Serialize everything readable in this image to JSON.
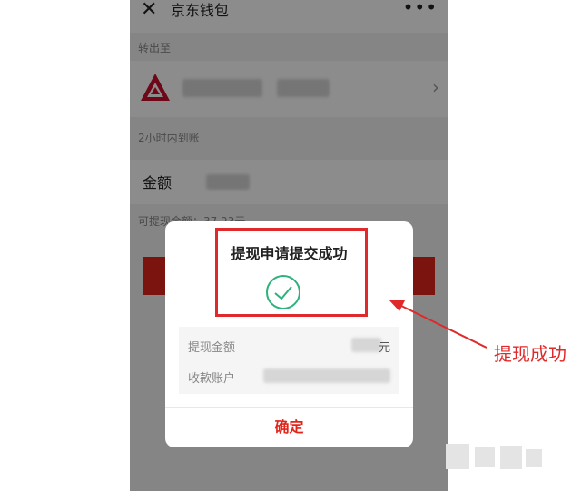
{
  "header": {
    "title": "京东钱包",
    "close_icon": "✕",
    "more_icon": "•••"
  },
  "transfer": {
    "section_label": "转出至",
    "arrival_note": "2小时内到账",
    "amount_label": "金额",
    "available_text": "可提现金额：37.23元"
  },
  "dialog": {
    "title": "提现申请提交成功",
    "rows": [
      {
        "label": "提现金额",
        "unit": "元"
      },
      {
        "label": "收款账户"
      }
    ],
    "confirm_label": "确定"
  },
  "annotation": {
    "text": "提现成功",
    "color": "#e0292a"
  },
  "colors": {
    "brand_red": "#e1251b",
    "success_green": "#2db27d"
  }
}
